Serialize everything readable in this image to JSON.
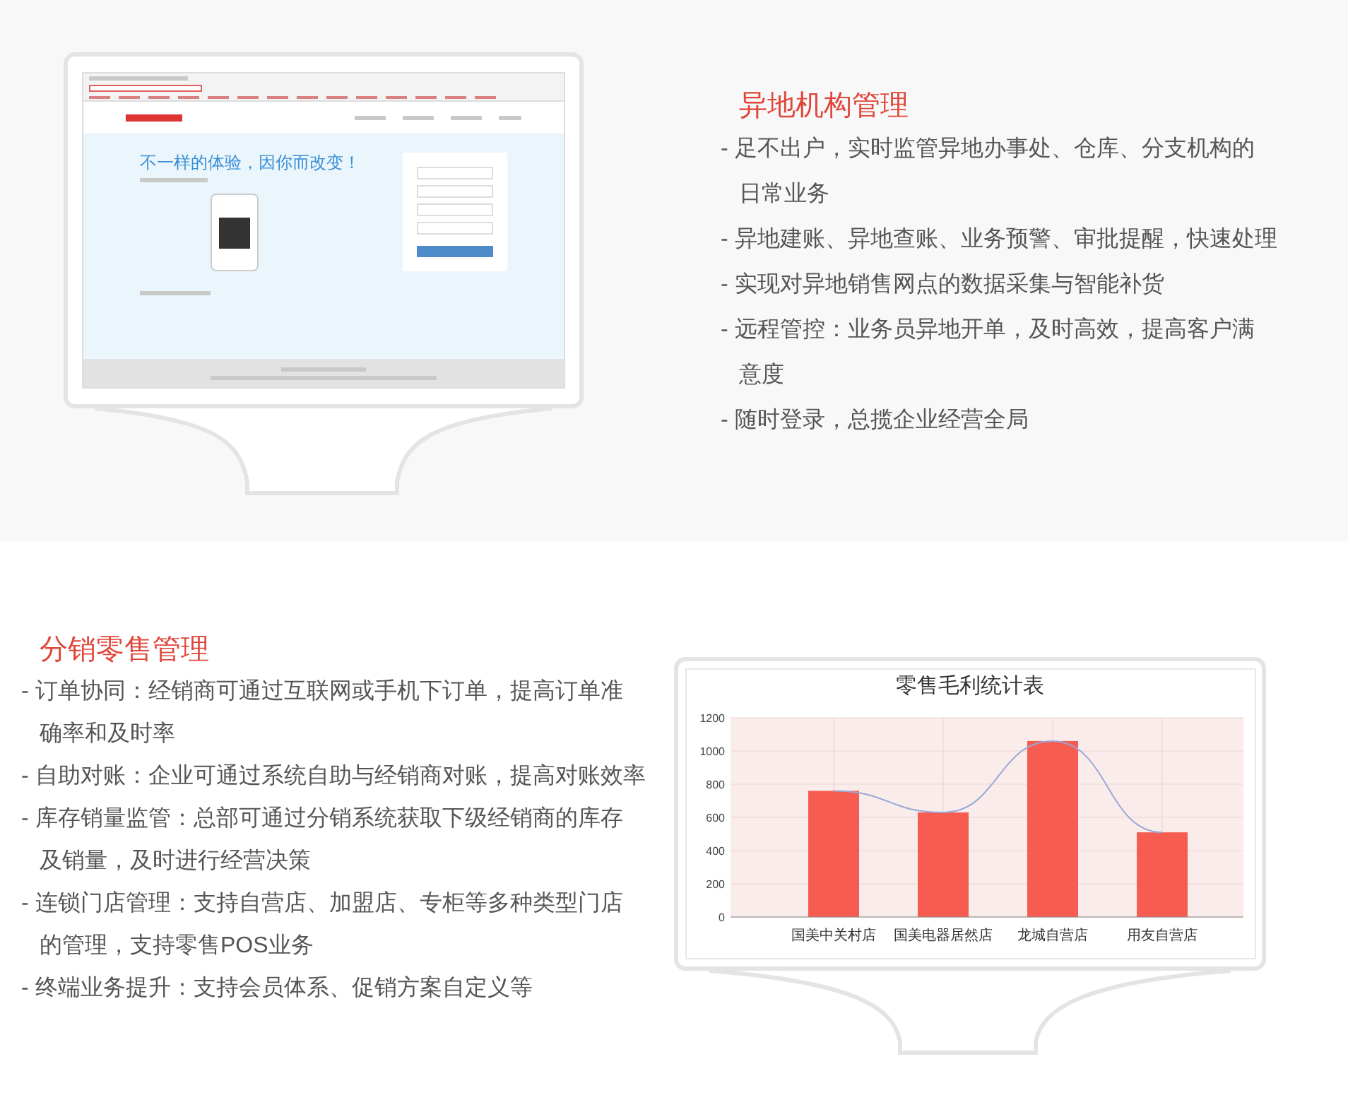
{
  "section_remote": {
    "title": "异地机构管理",
    "items": [
      {
        "lines": [
          "- 足不出户，实时监管异地办事处、仓库、分支机构的",
          "日常业务"
        ]
      },
      {
        "lines": [
          "- 异地建账、异地查账、业务预警、审批提醒，快速处理"
        ]
      },
      {
        "lines": [
          "- 实现对异地销售网点的数据采集与智能补货"
        ]
      },
      {
        "lines": [
          "- 远程管控：业务员异地开单，及时高效，提高客户满",
          "意度"
        ]
      },
      {
        "lines": [
          "- 随时登录，总揽企业经营全局"
        ]
      }
    ],
    "screen": {
      "slogan": "不一样的体验，因你而改变！"
    }
  },
  "section_retail": {
    "title": "分销零售管理",
    "items": [
      {
        "lines": [
          "- 订单协同：经销商可通过互联网或手机下订单，提高订单准",
          "确率和及时率"
        ]
      },
      {
        "lines": [
          "- 自助对账：企业可通过系统自助与经销商对账，提高对账效率"
        ]
      },
      {
        "lines": [
          "- 库存销量监管：总部可通过分销系统获取下级经销商的库存",
          "及销量，及时进行经营决策"
        ]
      },
      {
        "lines": [
          "- 连锁门店管理：支持自营店、加盟店、专柜等多种类型门店",
          "的管理，支持零售POS业务"
        ]
      },
      {
        "lines": [
          "- 终端业务提升：支持会员体系、促销方案自定义等"
        ]
      }
    ],
    "chart_data": {
      "type": "bar",
      "title": "零售毛利统计表",
      "categories": [
        "国美中关村店",
        "国美电器居然店",
        "龙城自营店",
        "用友自营店"
      ],
      "series": [
        {
          "color": "#f65c4f",
          "values": [
            760,
            630,
            1060,
            510
          ]
        },
        {
          "type": "line",
          "color": "#9aa8d8",
          "values": [
            760,
            630,
            1060,
            510
          ]
        }
      ],
      "grid": true,
      "ylim": [
        0,
        1200
      ],
      "yticks": [
        0,
        200,
        400,
        600,
        800,
        1000,
        1200
      ]
    }
  }
}
